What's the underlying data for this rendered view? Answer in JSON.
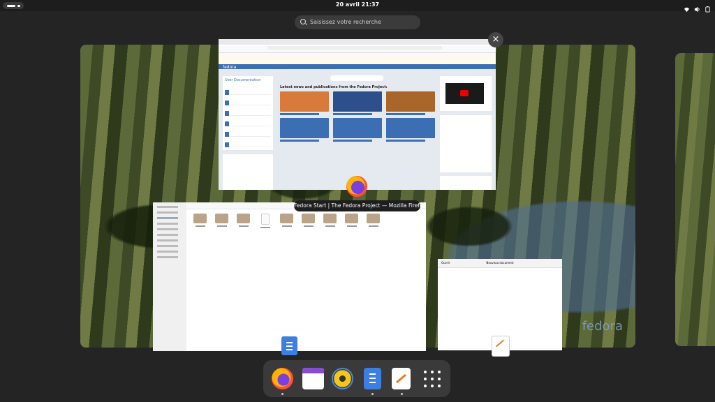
{
  "topbar": {
    "activities_icon": "activities-pill-icon",
    "clock": "20 avril  21:37",
    "tray_icons": [
      "wifi-icon",
      "volume-icon",
      "battery-icon"
    ]
  },
  "search": {
    "placeholder": "Saisissez votre recherche",
    "icon": "search-icon"
  },
  "overview": {
    "close_icon": "×",
    "tooltip": "Fedora Start | The Fedora Project — Mozilla Firefox",
    "watermark": "fedora"
  },
  "firefox_window": {
    "nav_brand": "fedora",
    "sidebar_heading": "User Documentation",
    "sidebar_items": [
      "Fedora Workstation",
      "Fedora Server",
      "Fedora Cloud",
      "Fedora CoreOS",
      "Fedora IoT",
      "Atomic Desktops"
    ],
    "common_issues": "Common Issues",
    "news_heading": "Latest news and publications from the Fedora Project:",
    "right_headings": [
      "Latest Council Video",
      "Latest Solved Issues",
      "Fedora Community Blog"
    ],
    "search_placeholder": "Search with DuckDuckGo"
  },
  "files_window": {
    "folders": [
      "Bureau",
      "Documents",
      "Images",
      "Spam 0.0.0",
      "Modèles",
      "Musique",
      "Public",
      "Téléchargements",
      "Vidéos"
    ]
  },
  "editor_window": {
    "menu": "Ouvrir",
    "title": "Nouveau document"
  },
  "dock": {
    "apps": [
      "Firefox",
      "Agenda",
      "Rhythmbox",
      "Fichiers",
      "Éditeur de texte",
      "Afficher les applications"
    ],
    "running": [
      true,
      false,
      false,
      true,
      true,
      false
    ]
  }
}
